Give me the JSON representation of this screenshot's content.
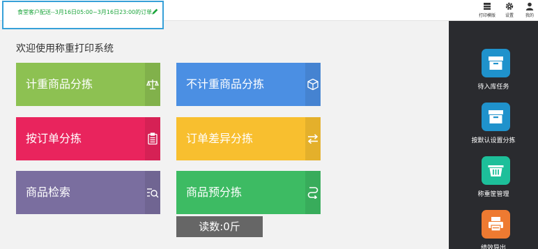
{
  "header": {
    "order_summary": "食堂客户配送--3月16日05:00~3月16日23:00的订单",
    "tools": [
      {
        "label": "打印模版",
        "icon": "print-template-icon"
      },
      {
        "label": "设置",
        "icon": "gear-icon"
      },
      {
        "label": "我的",
        "icon": "user-icon"
      }
    ]
  },
  "main": {
    "welcome": "欢迎使用称重打印系统",
    "tiles": [
      {
        "label": "计重商品分拣",
        "icon": "balance-scale-icon",
        "color": "#8dc152"
      },
      {
        "label": "不计重商品分拣",
        "icon": "cube-icon",
        "color": "#4b8fe3"
      },
      {
        "label": "按订单分拣",
        "icon": "clipboard-icon",
        "color": "#e9245d"
      },
      {
        "label": "订单差异分拣",
        "icon": "swap-arrows-icon",
        "color": "#f8bf2f"
      },
      {
        "label": "商品检索",
        "icon": "list-search-icon",
        "color": "#7a6e9f"
      },
      {
        "label": "商品预分拣",
        "icon": "route-icon",
        "color": "#3dbb63"
      }
    ],
    "reading": "读数:0斤"
  },
  "sidebar": {
    "items": [
      {
        "label": "待入库任务",
        "icon": "storage-box-icon",
        "color": "#1f92cc"
      },
      {
        "label": "按默认设置分拣",
        "icon": "storage-box-icon",
        "color": "#1f92cc"
      },
      {
        "label": "称重筐管理",
        "icon": "basket-icon",
        "color": "#1dbf9a"
      },
      {
        "label": "绩效导出",
        "icon": "printer-icon",
        "color": "#ee7a31"
      }
    ]
  }
}
